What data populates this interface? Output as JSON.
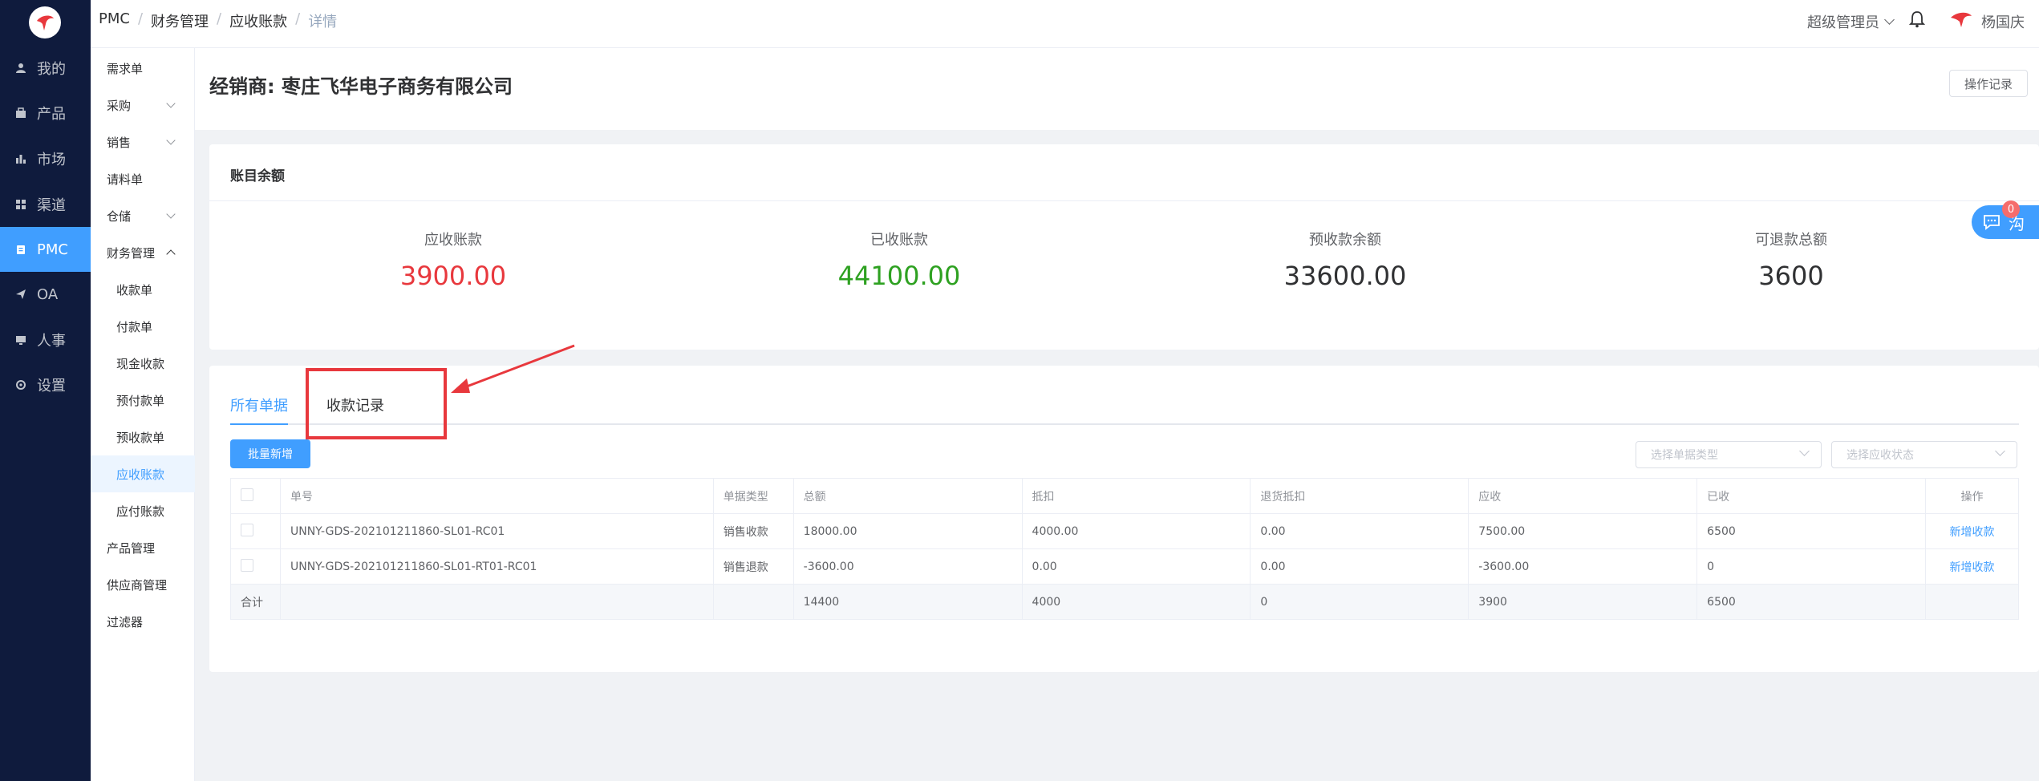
{
  "nav": {
    "items": [
      {
        "label": "我的",
        "icon": "user-icon"
      },
      {
        "label": "产品",
        "icon": "bag-icon"
      },
      {
        "label": "市场",
        "icon": "bar-chart-icon"
      },
      {
        "label": "渠道",
        "icon": "grid-icon"
      },
      {
        "label": "PMC",
        "icon": "clipboard-icon"
      },
      {
        "label": "OA",
        "icon": "send-icon"
      },
      {
        "label": "人事",
        "icon": "monitor-icon"
      },
      {
        "label": "设置",
        "icon": "gear-icon"
      }
    ],
    "active": "PMC"
  },
  "subnav": {
    "items": [
      "需求单",
      "采购",
      "销售",
      "请料单",
      "仓储",
      "财务管理",
      "收款单",
      "付款单",
      "现金收款",
      "预付款单",
      "预收款单",
      "应收账款",
      "应付账款",
      "产品管理",
      "供应商管理",
      "过滤器"
    ],
    "active": "应收账款"
  },
  "breadcrumb": [
    "PMC",
    "财务管理",
    "应收账款",
    "详情"
  ],
  "user": {
    "role": "超级管理员",
    "name": "杨国庆"
  },
  "header": {
    "title": "经销商: 枣庄飞华电子商务有限公司",
    "log_button": "操作记录"
  },
  "balance": {
    "heading": "账目余额",
    "stats": [
      {
        "label": "应收账款",
        "value": "3900.00",
        "color": "#e8383d"
      },
      {
        "label": "已收账款",
        "value": "44100.00",
        "color": "#2ea121"
      },
      {
        "label": "预收款余额",
        "value": "33600.00",
        "color": "#303133"
      },
      {
        "label": "可退款总额",
        "value": "3600",
        "color": "#303133"
      }
    ]
  },
  "chat": {
    "label": "沟",
    "badge": "0"
  },
  "tabs": {
    "all": "所有单据",
    "receipts": "收款记录"
  },
  "toolbar": {
    "batch_add": "批量新增",
    "select_type_placeholder": "选择单据类型",
    "select_status_placeholder": "选择应收状态"
  },
  "table": {
    "headers": [
      "单号",
      "单据类型",
      "总额",
      "抵扣",
      "退货抵扣",
      "应收",
      "已收",
      "操作"
    ],
    "rows": [
      {
        "no": "UNNY-GDS-202101211860-SL01-RC01",
        "type": "销售收款",
        "total": "18000.00",
        "deduct": "4000.00",
        "return_deduct": "0.00",
        "receivable": "7500.00",
        "received": "6500",
        "action": "新增收款"
      },
      {
        "no": "UNNY-GDS-202101211860-SL01-RT01-RC01",
        "type": "销售退款",
        "total": "-3600.00",
        "deduct": "0.00",
        "return_deduct": "0.00",
        "receivable": "-3600.00",
        "received": "0",
        "action": "新增收款"
      }
    ],
    "summary": {
      "label": "合计",
      "total": "14400",
      "deduct": "4000",
      "return_deduct": "0",
      "receivable": "3900",
      "received": "6500"
    }
  }
}
